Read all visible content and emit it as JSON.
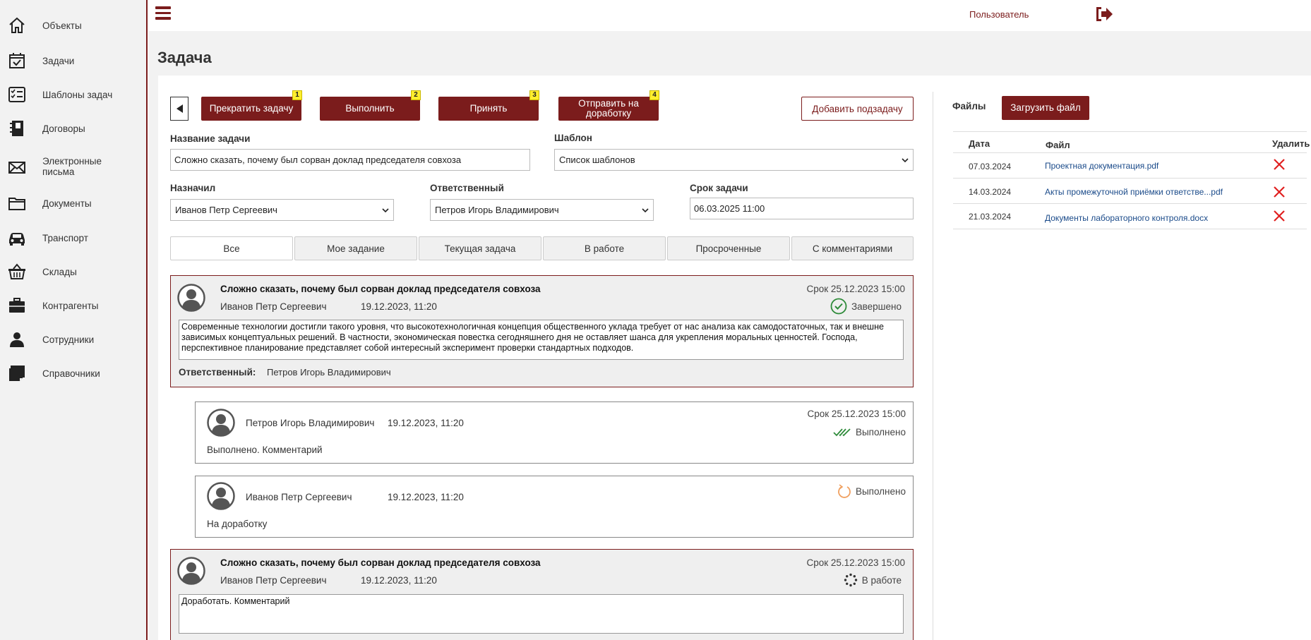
{
  "sidebar": {
    "items": [
      {
        "label": "Объекты",
        "icon": "home-icon"
      },
      {
        "label": "Задачи",
        "icon": "calendar-check-icon"
      },
      {
        "label": "Шаблоны задач",
        "icon": "checklist-icon"
      },
      {
        "label": "Договоры",
        "icon": "notebook-icon"
      },
      {
        "label": "Электронные письма",
        "icon": "envelope-icon"
      },
      {
        "label": "Документы",
        "icon": "folder-icon"
      },
      {
        "label": "Транспорт",
        "icon": "car-icon"
      },
      {
        "label": "Склады",
        "icon": "basket-icon"
      },
      {
        "label": "Контрагенты",
        "icon": "briefcase-icon"
      },
      {
        "label": "Сотрудники",
        "icon": "person-icon"
      },
      {
        "label": "Справочники",
        "icon": "sticky-note-icon"
      }
    ]
  },
  "topbar": {
    "user": "Пользователь"
  },
  "page": {
    "title": "Задача"
  },
  "toolbar": {
    "buttons": [
      {
        "label": "Прекратить задачу",
        "badge": "1"
      },
      {
        "label": "Выполнить",
        "badge": "2"
      },
      {
        "label": "Принять",
        "badge": "3"
      },
      {
        "label": "Отправить на доработку",
        "badge": "4"
      }
    ],
    "add_subtask": "Добавить подзадачу"
  },
  "form": {
    "task_name_label": "Название задачи",
    "task_name_value": "Сложно сказать, почему был сорван доклад председателя совхоза",
    "template_label": "Шаблон",
    "template_value": "Список шаблонов",
    "assigned_by_label": "Назначил",
    "assigned_by_value": "Иванов Петр Сергеевич",
    "responsible_label": "Ответственный",
    "responsible_value": "Петров Игорь Владимирович",
    "deadline_label": "Срок задачи",
    "deadline_value": "06.03.2025 11:00"
  },
  "tabs": [
    "Все",
    "Мое задание",
    "Текущая задача",
    "В работе",
    "Просроченные",
    "С комментариями"
  ],
  "cards": [
    {
      "title": "Сложно сказать, почему был сорван доклад председателя совхоза",
      "author": "Иванов Петр Сергеевич",
      "date": "19.12.2023, 11:20",
      "deadline": "Срок 25.12.2023 15:00",
      "status": "Завершено",
      "body": "Современные технологии достигли такого уровня, что высокотехнологичная концепция общественного уклада требует от нас анализа как самодостаточных, так и внешне зависимых концептуальных решений. В частности, экономическая повестка сегодняшнего дня не оставляет шанса для укрепления моральных ценностей. Господа, перспективное планирование представляет собой интересный эксперимент проверки стандартных подходов.",
      "responsible_label": "Ответственный:",
      "responsible_value": "Петров Игорь Владимирович"
    },
    {
      "author": "Петров Игорь Владимирович",
      "date": "19.12.2023, 11:20",
      "deadline": "Срок 25.12.2023 15:00",
      "status": "Выполнено",
      "text": "Выполнено. Комментарий"
    },
    {
      "author": "Иванов Петр Сергеевич",
      "date": "19.12.2023, 11:20",
      "status": "Выполнено",
      "text": "На доработку"
    },
    {
      "title": "Сложно сказать, почему был сорван доклад председателя совхоза",
      "author": "Иванов Петр Сергеевич",
      "date": "19.12.2023, 11:20",
      "deadline": "Срок 25.12.2023 15:00",
      "status": "В работе",
      "body": "Доработать. Комментарий"
    }
  ],
  "files": {
    "label": "Файлы",
    "upload": "Загрузить файл",
    "headers": {
      "date": "Дата",
      "file": "Файл",
      "delete": "Удалить"
    },
    "rows": [
      {
        "date": "07.03.2024",
        "name": "Проектная документация.pdf"
      },
      {
        "date": "14.03.2024",
        "name": "Акты промежуточной приёмки ответстве...pdf"
      },
      {
        "date": "21.03.2024",
        "name": "Документы лабораторного контроля.docx"
      }
    ]
  },
  "colors": {
    "brand": "#7b1c1c",
    "badge": "#ffee2e",
    "done_green": "#2e8b3a",
    "redo_orange": "#f0a060",
    "delete_red": "#e02020"
  }
}
